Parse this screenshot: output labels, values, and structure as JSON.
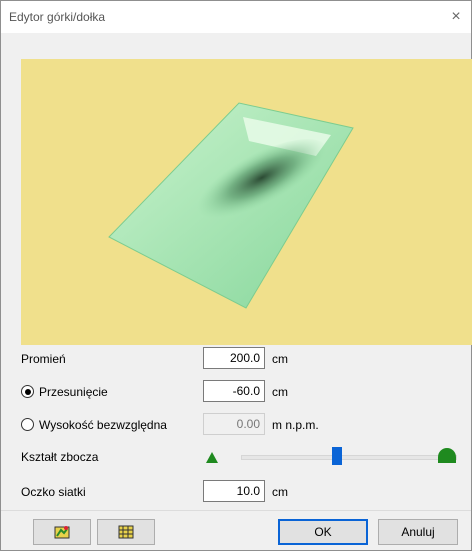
{
  "window": {
    "title": "Edytor górki/dołka",
    "close_glyph": "×"
  },
  "fields": {
    "radius": {
      "label": "Promień",
      "value": "200.0",
      "unit": "cm"
    },
    "offset": {
      "label": "Przesunięcie",
      "value": "-60.0",
      "unit": "cm",
      "selected": true
    },
    "absolute_height": {
      "label": "Wysokość bezwzględna",
      "value": "0.00",
      "unit": "m n.p.m.",
      "selected": false,
      "disabled": true
    },
    "slope_shape": {
      "label": "Kształt zbocza",
      "level": 0.46,
      "min_icon": "small-hill-icon",
      "max_icon": "large-hill-icon"
    },
    "mesh": {
      "label": "Oczko siatki",
      "value": "10.0",
      "unit": "cm"
    }
  },
  "buttons": {
    "ok": "OK",
    "cancel": "Anuluj",
    "tool1_icon": "mesh-preview-icon",
    "tool2_icon": "grid-toggle-icon"
  },
  "colors": {
    "preview_bg": "#f0e08c",
    "surface": "#a8e6ae",
    "accent": "#0a64d6",
    "hill_icon": "#1f8a1f"
  }
}
